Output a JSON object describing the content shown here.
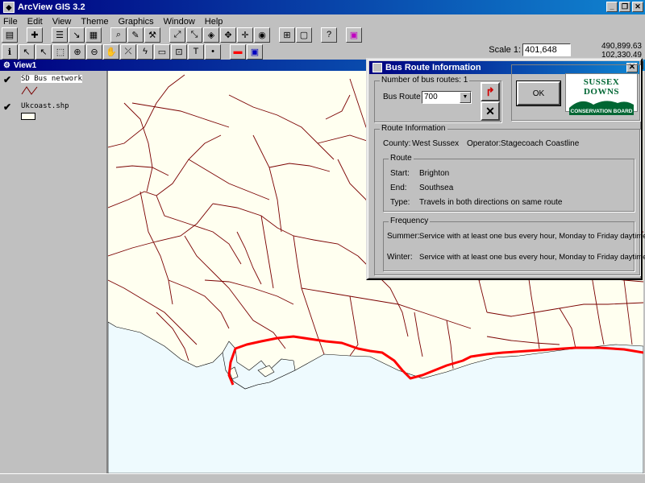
{
  "app": {
    "title": "ArcView GIS 3.2"
  },
  "menu": [
    "File",
    "Edit",
    "View",
    "Theme",
    "Graphics",
    "Window",
    "Help"
  ],
  "toolbar": {
    "scale_label": "Scale 1:",
    "scale_value": "401,648",
    "coord_x": "490,899.63",
    "coord_y": "102,330.49"
  },
  "view": {
    "title": "View1",
    "themes": [
      {
        "name": "SD Bus network",
        "checked": "✔"
      },
      {
        "name": "Ukcoast.shp",
        "checked": "✔"
      }
    ]
  },
  "dialog": {
    "title": "Bus Route Information",
    "routes_count_label": "Number of bus routes: 1",
    "bus_route_label": "Bus Route",
    "bus_route_value": "700",
    "ok_label": "OK",
    "logo": {
      "line1": "SUSSEX DOWNS",
      "line2": "CONSERVATION BOARD"
    },
    "route_information_label": "Route Information",
    "county_label": "County:",
    "county_value": "West Sussex",
    "operator_label": "Operator:",
    "operator_value": "Stagecoach Coastline",
    "route_label": "Route",
    "start_label": "Start:",
    "start_value": "Brighton",
    "end_label": "End:",
    "end_value": "Southsea",
    "type_label": "Type:",
    "type_value": "Travels in both directions on same route",
    "frequency_label": "Frequency",
    "summer_label": "Summer:",
    "summer_value": "Service with at least one bus every hour, Monday to Friday daytime",
    "winter_label": "Winter:",
    "winter_value": "Service with at least one bus every hour, Monday to Friday daytime"
  },
  "colors": {
    "titlebar": "#000080",
    "route_highlight": "#ff0000",
    "bus_network": "#7a0000",
    "sea": "#eefafe",
    "land": "#fffff0",
    "logo_green": "#006633"
  }
}
